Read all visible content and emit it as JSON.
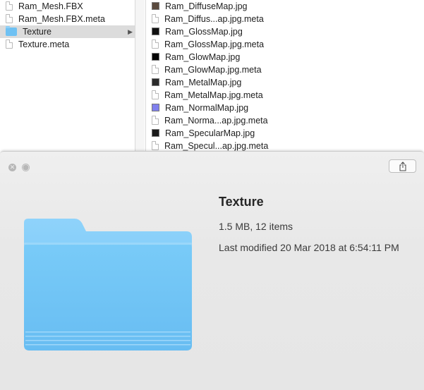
{
  "finder": {
    "column1": [
      {
        "label": "Ram_Mesh.FBX",
        "icon": "document-icon",
        "selected": false
      },
      {
        "label": "Ram_Mesh.FBX.meta",
        "icon": "document-icon",
        "selected": false
      },
      {
        "label": "Texture",
        "icon": "folder-icon",
        "selected": true
      },
      {
        "label": "Texture.meta",
        "icon": "document-icon",
        "selected": false
      }
    ],
    "column2": [
      {
        "label": "Ram_DiffuseMap.jpg",
        "icon": "image-thumbnail-icon",
        "thumb_color": "#5a4a3e"
      },
      {
        "label": "Ram_Diffus...ap.jpg.meta",
        "icon": "document-icon"
      },
      {
        "label": "Ram_GlossMap.jpg",
        "icon": "image-thumbnail-icon",
        "thumb_color": "#111111"
      },
      {
        "label": "Ram_GlossMap.jpg.meta",
        "icon": "document-icon"
      },
      {
        "label": "Ram_GlowMap.jpg",
        "icon": "image-thumbnail-icon",
        "thumb_color": "#050505"
      },
      {
        "label": "Ram_GlowMap.jpg.meta",
        "icon": "document-icon"
      },
      {
        "label": "Ram_MetalMap.jpg",
        "icon": "image-thumbnail-icon",
        "thumb_color": "#2b2b2b"
      },
      {
        "label": "Ram_MetalMap.jpg.meta",
        "icon": "document-icon"
      },
      {
        "label": "Ram_NormalMap.jpg",
        "icon": "image-thumbnail-icon",
        "thumb_color": "#8080ee"
      },
      {
        "label": "Ram_Norma...ap.jpg.meta",
        "icon": "document-icon"
      },
      {
        "label": "Ram_SpecularMap.jpg",
        "icon": "image-thumbnail-icon",
        "thumb_color": "#1a1a1a"
      },
      {
        "label": "Ram_Specul...ap.jpg.meta",
        "icon": "document-icon"
      }
    ]
  },
  "quicklook": {
    "title": "Texture",
    "size": "1.5 MB, 12 items",
    "modified": "Last modified 20 Mar 2018 at 6:54:11 PM",
    "folder_color": "#6ec2f5"
  }
}
